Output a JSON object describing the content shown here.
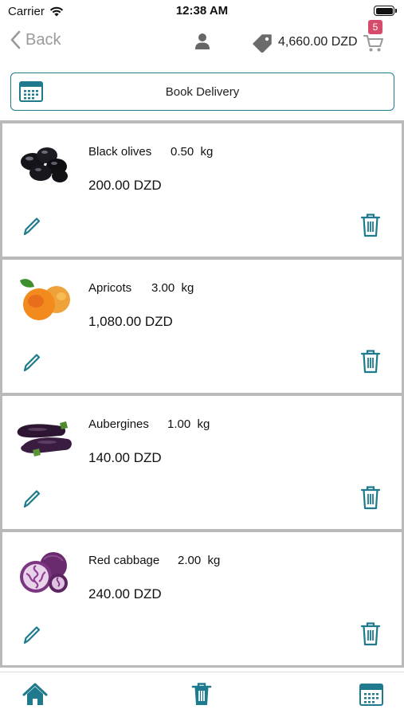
{
  "status_bar": {
    "carrier": "Carrier",
    "time": "12:38 AM"
  },
  "nav": {
    "back_label": "Back",
    "total": "4,660.00 DZD",
    "cart_count": "5",
    "icons": [
      "chevron-left-icon",
      "user-icon",
      "price-tag-icon",
      "cart-icon"
    ]
  },
  "book_delivery": {
    "label": "Book Delivery",
    "icon": "calendar-icon"
  },
  "items": [
    {
      "name": "Black olives",
      "quantity": "0.50",
      "unit": "kg",
      "price": "200.00 DZD",
      "image": "black-olives-image"
    },
    {
      "name": "Apricots",
      "quantity": "3.00",
      "unit": "kg",
      "price": "1,080.00 DZD",
      "image": "apricots-image"
    },
    {
      "name": "Aubergines",
      "quantity": "1.00",
      "unit": "kg",
      "price": "140.00 DZD",
      "image": "aubergines-image"
    },
    {
      "name": "Red cabbage",
      "quantity": "2.00",
      "unit": "kg",
      "price": "240.00 DZD",
      "image": "red-cabbage-image"
    }
  ],
  "tab_bar": {
    "icons": [
      "home-icon",
      "trash-icon",
      "calendar-icon"
    ]
  },
  "colors": {
    "accent": "#1e7a8c",
    "badge": "#d64b6c",
    "separator": "#b9b9b9",
    "back_text": "#9a9a9a"
  }
}
